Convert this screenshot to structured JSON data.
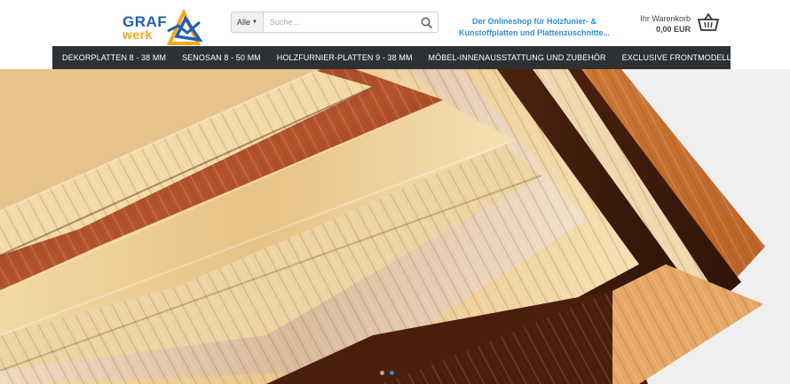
{
  "brand": {
    "logo_line1": "GRAF",
    "logo_line2": "werk",
    "blue": "#1f5fb0",
    "orange": "#f4a91a"
  },
  "search": {
    "category_selected": "Alle",
    "placeholder": "Suche...",
    "icon": "search-icon"
  },
  "tagline": {
    "line1": "Der Onlineshop für Holzfunier- &",
    "line2": "Kunstoffplatten und Plattenzuschnitte..."
  },
  "cart": {
    "label": "Ihr Warenkorb",
    "total": "0,00 EUR",
    "icon": "basket-icon"
  },
  "nav": {
    "items": [
      {
        "label": "DEKORPLATTEN 8 - 38 MM"
      },
      {
        "label": "SENOSAN 8 - 50 MM"
      },
      {
        "label": "HOLZFURNIER-PLATTEN 9 - 38 MM"
      },
      {
        "label": "MÖBEL-INNENAUSSTATTUNG UND ZUBEHÖR"
      },
      {
        "label": "EXCLUSIVE FRONTMODELLE"
      }
    ]
  },
  "colors": {
    "accent": "#2a8fd8",
    "nav_bg": "#2e3133"
  }
}
